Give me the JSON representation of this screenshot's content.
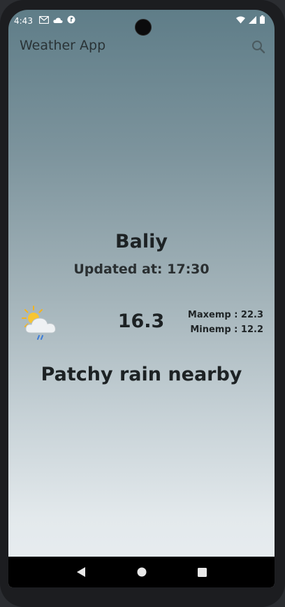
{
  "status_bar": {
    "time": "4:43",
    "left_icons": [
      "gmail-icon",
      "cloud-icon",
      "app-icon"
    ],
    "right_icons": [
      "wifi-icon",
      "signal-icon",
      "battery-icon"
    ]
  },
  "toolbar": {
    "title": "Weather App",
    "search_icon": "search-icon"
  },
  "weather": {
    "city": "Baliy",
    "updated": "Updated at: 17:30",
    "icon": "partly-cloudy-rain-icon",
    "temperature": "16.3",
    "max_temp": "Maxemp : 22.3",
    "min_temp": "Minemp : 12.2",
    "condition": "Patchy rain nearby"
  },
  "nav_bar": {
    "buttons": [
      "back-icon",
      "home-icon",
      "recents-icon"
    ]
  },
  "colors": {
    "gradient_top": "#5f7d88",
    "gradient_bottom": "#e9eef1",
    "text_dark": "#1d2224"
  }
}
